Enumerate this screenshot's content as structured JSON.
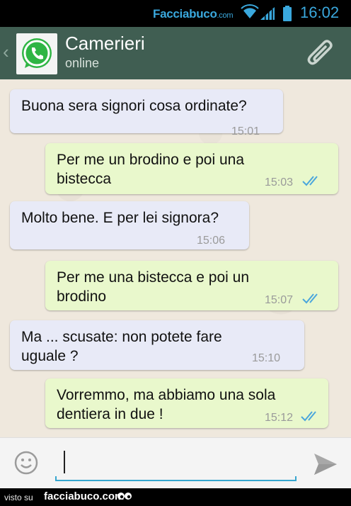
{
  "status_bar": {
    "brand_main": "Facciabuco",
    "brand_domain": ".com",
    "time": "16:02",
    "accent_color": "#3aa8dd"
  },
  "header": {
    "title": "Camerieri",
    "subtitle": "online",
    "icons": [
      "back-chevron-icon",
      "whatsapp-avatar-icon",
      "paperclip-icon"
    ],
    "background": "#405e52"
  },
  "messages": [
    {
      "direction": "in",
      "lines": [
        "Buona sera signori cosa ordinate?"
      ],
      "time": "15:01",
      "read": false
    },
    {
      "direction": "out",
      "lines": [
        "Per me un brodino e poi una",
        "bistecca"
      ],
      "time": "15:03",
      "read": true
    },
    {
      "direction": "in",
      "lines": [
        "Molto bene. E per lei signora?"
      ],
      "time": "15:06",
      "read": false
    },
    {
      "direction": "out",
      "lines": [
        "Per me una bistecca e poi un",
        "brodino"
      ],
      "time": "15:07",
      "read": true
    },
    {
      "direction": "in",
      "lines": [
        "Ma ... scusate: non potete fare",
        "uguale ?"
      ],
      "time": "15:10",
      "read": false
    },
    {
      "direction": "out",
      "lines": [
        "Vorremmo, ma abbiamo una sola",
        "dentiera in due !"
      ],
      "time": "15:12",
      "read": true
    }
  ],
  "colors": {
    "incoming_bubble": "#e8eaf7",
    "outgoing_bubble": "#e9f8cc",
    "read_ticks": "#4aa6dc"
  },
  "input": {
    "value": "",
    "icons": [
      "smiley-icon",
      "send-icon"
    ]
  },
  "footer": {
    "prefix": "visto su",
    "site": "facciabuco.com"
  }
}
